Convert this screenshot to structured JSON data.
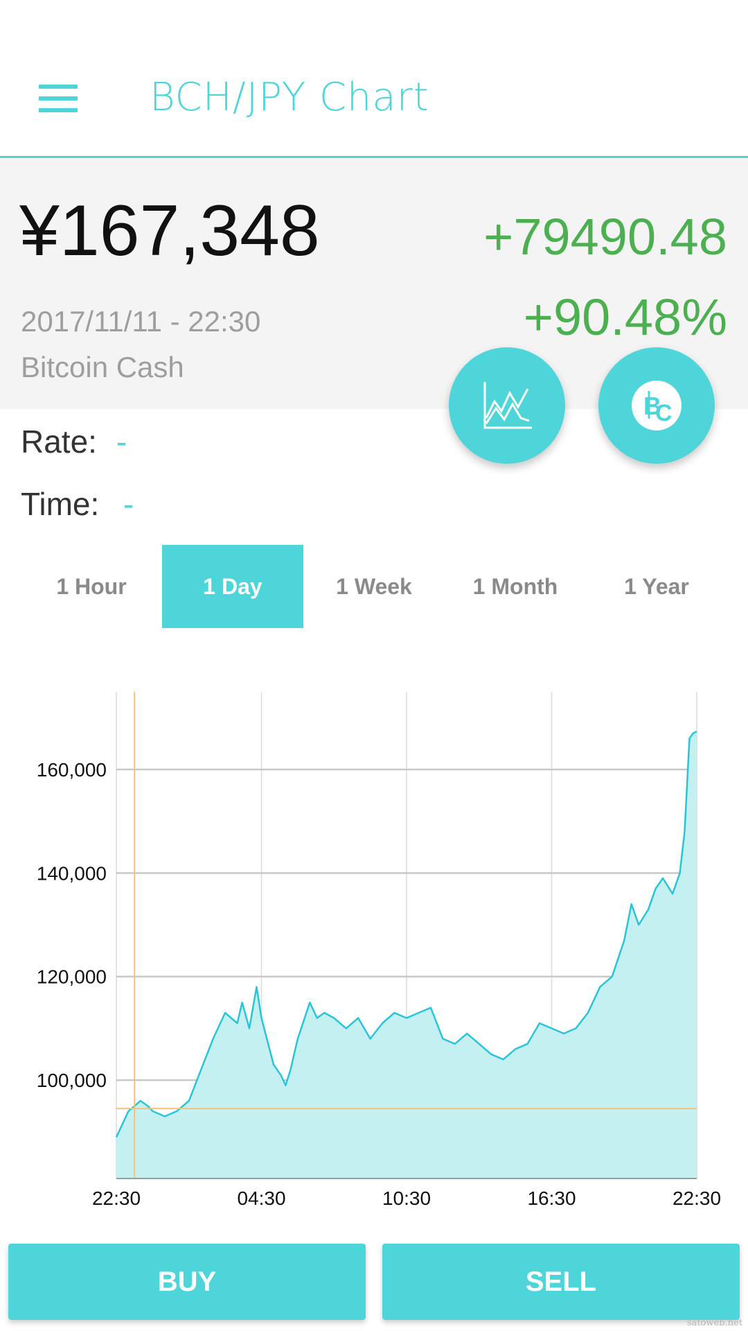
{
  "app": {
    "title": "BCH/JPY Chart"
  },
  "summary": {
    "price": "¥167,348",
    "change_abs": "+79490.48",
    "change_pct": "+90.48%",
    "date": "2017/11/11 - 22:30",
    "coin_name": "Bitcoin Cash"
  },
  "rate": {
    "label": "Rate:",
    "value": "-"
  },
  "time": {
    "label": "Time:",
    "value": "-"
  },
  "ranges": [
    {
      "label": "1 Hour",
      "active": false
    },
    {
      "label": "1 Day",
      "active": true
    },
    {
      "label": "1 Week",
      "active": false
    },
    {
      "label": "1 Month",
      "active": false
    },
    {
      "label": "1 Year",
      "active": false
    }
  ],
  "actions": {
    "buy": "BUY",
    "sell": "SELL"
  },
  "watermark": "satoweb.net",
  "colors": {
    "accent": "#4dd5d9",
    "positive": "#4caf50",
    "line": "#29c4d8",
    "area": "#c5f0f1",
    "crosshair": "#f6c27a",
    "grid": "#c8c8c8"
  },
  "icons": {
    "fab_chart": "line-chart-icon",
    "fab_coin": "bitcoin-cash-icon",
    "menu": "hamburger-menu-icon"
  },
  "chart_data": {
    "type": "area",
    "x_ticks": [
      "22:30",
      "04:30",
      "10:30",
      "16:30",
      "22:30"
    ],
    "x_range": [
      0,
      24
    ],
    "y_ticks": [
      100000,
      120000,
      140000,
      160000
    ],
    "y_tick_labels": [
      "100,000",
      "120,000",
      "140,000",
      "160,000"
    ],
    "ylim": [
      81000,
      175000
    ],
    "series": [
      {
        "x": [
          0,
          0.5,
          1,
          1.3,
          1.5,
          2,
          2.5,
          3,
          3.5,
          4,
          4.5,
          5,
          5.2,
          5.5,
          5.8,
          6,
          6.5,
          6.8,
          7,
          7.2,
          7.5,
          8,
          8.3,
          8.6,
          9,
          9.5,
          10,
          10.5,
          11,
          11.5,
          12,
          12.5,
          13,
          13.5,
          14,
          14.5,
          15,
          15.5,
          16,
          16.5,
          17,
          17.5,
          18,
          18.5,
          19,
          19.5,
          20,
          20.5,
          21,
          21.3,
          21.6,
          22,
          22.3,
          22.6,
          23,
          23.3,
          23.5,
          23.7,
          23.85,
          24
        ],
        "values": [
          89000,
          94000,
          96000,
          95000,
          94000,
          93000,
          94000,
          96000,
          102000,
          108000,
          113000,
          111000,
          115000,
          110000,
          118000,
          112000,
          103000,
          101000,
          99000,
          102000,
          108000,
          115000,
          112000,
          113000,
          112000,
          110000,
          112000,
          108000,
          111000,
          113000,
          112000,
          113000,
          114000,
          108000,
          107000,
          109000,
          107000,
          105000,
          104000,
          106000,
          107000,
          111000,
          110000,
          109000,
          110000,
          113000,
          118000,
          120000,
          127000,
          134000,
          130000,
          133000,
          137000,
          139000,
          136000,
          140000,
          148000,
          166000,
          167000,
          167348
        ]
      }
    ],
    "crosshair": {
      "x": 0.75,
      "y": 94500
    },
    "grid": true,
    "legend": "none"
  }
}
